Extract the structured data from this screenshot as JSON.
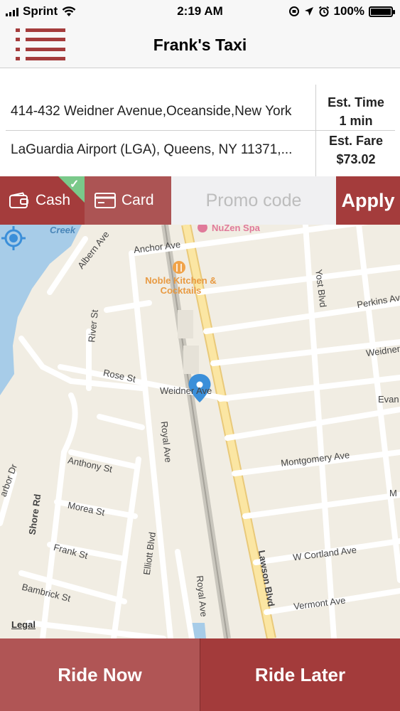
{
  "status_bar": {
    "carrier": "Sprint",
    "time": "2:19 AM",
    "battery_text": "100%",
    "battery_level": 1.0
  },
  "nav": {
    "title": "Frank's Taxi",
    "menu_icon": "hamburger-list-icon"
  },
  "trip": {
    "pickup": "414-432 Weidner Avenue,Oceanside,New York",
    "dropoff": "LaGuardia Airport (LGA), Queens, NY 11371,...",
    "est_time_label": "Est. Time",
    "est_time_value": "1 min",
    "est_fare_label": "Est. Fare",
    "est_fare_value": "$73.02"
  },
  "payment": {
    "cash_label": "Cash",
    "card_label": "Card",
    "selected": "Cash",
    "promo_placeholder": "Promo code",
    "apply_label": "Apply"
  },
  "map": {
    "labels": {
      "creek": "Creek",
      "albern": "Albern Ave",
      "anchor": "Anchor Ave",
      "nuzen": "NuZen Spa",
      "noble": "Noble Kitchen & Cocktails",
      "yost": "Yost Blvd",
      "perkins": "Perkins Av",
      "river": "River St",
      "weidner_right": "Weidner",
      "rose": "Rose St",
      "weidner_center": "Weidner Ave",
      "evans": "Evan",
      "royal1": "Royal Ave",
      "anthony": "Anthony St",
      "montgomery": "Montgomery Ave",
      "harbor": "arbor Dr",
      "shore": "Shore Rd",
      "morea": "Morea St",
      "elliott": "Elliott Blvd",
      "frank": "Frank St",
      "lawson": "Lawson Blvd",
      "cortland": "W Cortland Ave",
      "bambrick": "Bambrick St",
      "royal2": "Royal Ave",
      "vermont": "Vermont Ave",
      "legal": "Legal",
      "m": "M"
    }
  },
  "actions": {
    "ride_now": "Ride Now",
    "ride_later": "Ride Later"
  },
  "colors": {
    "brand": "#a43c3c",
    "brand_light": "#b05555",
    "check": "#7ac98a",
    "map_bg": "#f1ede3",
    "water": "#a7cce8",
    "pin": "#3b8fd9"
  }
}
